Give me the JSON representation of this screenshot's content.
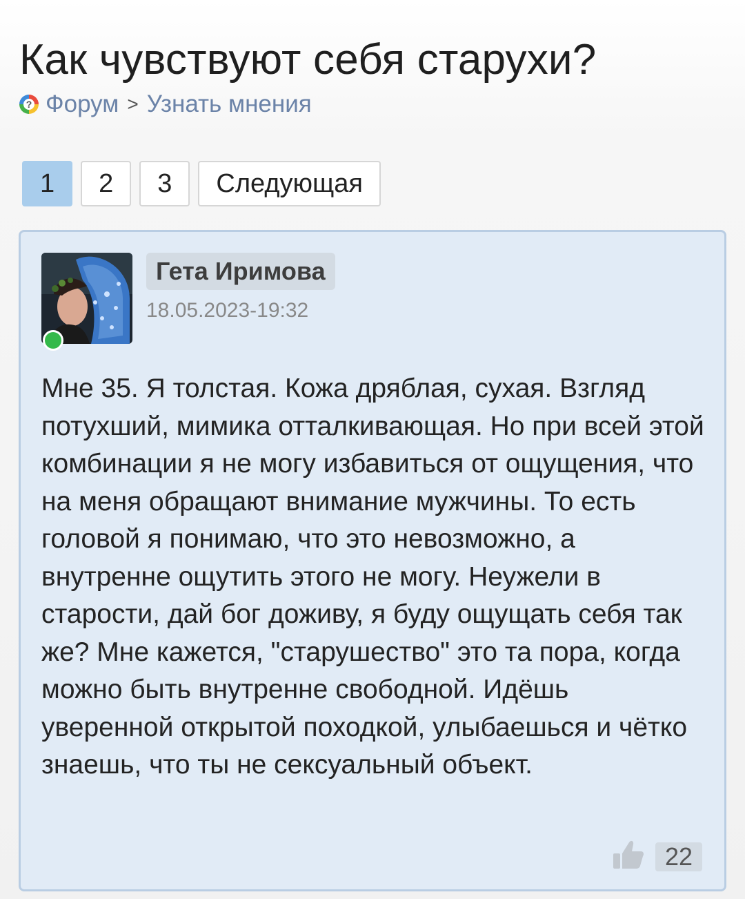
{
  "title": "Как чувствуют себя старухи?",
  "breadcrumb": {
    "icon": "forum-question-icon",
    "forum": "Форум",
    "separator": ">",
    "section": "Узнать мнения"
  },
  "pagination": {
    "pages": [
      "1",
      "2",
      "3"
    ],
    "active": "1",
    "next": "Следующая"
  },
  "post": {
    "author": "Гета Иримова",
    "date": "18.05.2023-19:32",
    "online": true,
    "text": "Мне 35. Я толстая. Кожа дряблая, сухая. Взгляд потухший, мимика отталкивающая. Но при всей этой комбинации я не могу избавиться от ощущения, что на меня обращают внимание мужчины. То есть головой я понимаю, что это невозможно, а внутренне ощутить этого не могу. Неужели в старости, дай бог доживу, я буду ощущать себя так же? Мне кажется, \"старушество\" это та пора, когда можно быть внутренне свободной. Идёшь уверенной открытой походкой, улыбаешься и чётко знаешь, что ты не сексуальный объект.",
    "likes": "22"
  },
  "colors": {
    "link": "#6b83a8",
    "active_page": "#a9cdec",
    "post_bg": "#e1ebf6",
    "post_border": "#b9cde3",
    "online": "#34b94a"
  }
}
